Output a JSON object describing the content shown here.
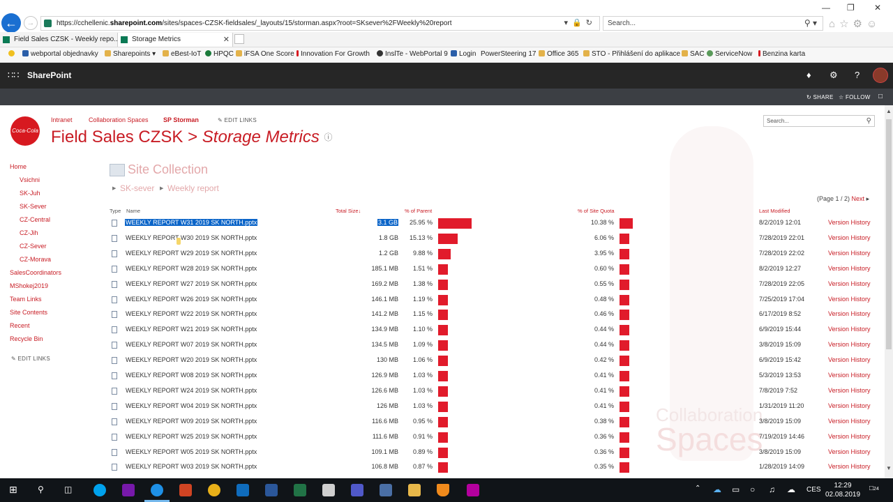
{
  "browser": {
    "url_prefix": "https://cchellenic.",
    "url_host": "sharepoint.com",
    "url_rest": "/sites/spaces-CZSK-fieldsales/_layouts/15/storman.aspx?root=SKsever%2FWeekly%20report",
    "search_placeholder": "Search...",
    "tabs": [
      {
        "label": "Field Sales CZSK - Weekly repo..."
      },
      {
        "label": "Storage Metrics"
      }
    ],
    "favorites": [
      "webportal objednavky",
      "Sharepoints",
      "eBest-IoT",
      "HPQC",
      "iFSA One Score",
      "Innovation For Growth",
      "InslTe - WebPortal 9",
      "Login",
      "PowerSteering 17",
      "Office 365",
      "STO - Přihlášení do aplikace",
      "SAC",
      "ServiceNow",
      "Benzina karta"
    ]
  },
  "suite": {
    "brand": "SharePoint",
    "share": "SHARE",
    "follow": "FOLLOW"
  },
  "site": {
    "logo_text": "Coca-Cola",
    "topnav": [
      "Intranet",
      "Collaboration Spaces",
      "SP Storman"
    ],
    "edit_links": "EDIT LINKS",
    "title_main": "Field Sales CZSK",
    "title_sep": " > ",
    "title_page": "Storage Metrics",
    "search_placeholder": "Search...",
    "leftnav": [
      {
        "label": "Home",
        "indent": false
      },
      {
        "label": "Vsichni",
        "indent": true
      },
      {
        "label": "SK-Juh",
        "indent": true
      },
      {
        "label": "SK-Sever",
        "indent": true
      },
      {
        "label": "CZ-Central",
        "indent": true
      },
      {
        "label": "CZ-Jih",
        "indent": true
      },
      {
        "label": "CZ-Sever",
        "indent": true
      },
      {
        "label": "CZ-Morava",
        "indent": true
      },
      {
        "label": "SalesCoordinators",
        "indent": false
      },
      {
        "label": "MShokej2019",
        "indent": false
      },
      {
        "label": "Team Links",
        "indent": false
      },
      {
        "label": "Site Contents",
        "indent": false
      },
      {
        "label": "Recent",
        "indent": false
      },
      {
        "label": "Recycle Bin",
        "indent": false
      }
    ],
    "leftnav_edit": "EDIT LINKS",
    "watermark_line1": "Collaboration",
    "watermark_line2": "Spaces"
  },
  "storage": {
    "heading": "Site Collection",
    "breadcrumb": [
      "SK-sever",
      "Weekly report"
    ],
    "pager_text": "(Page 1 / 2)",
    "pager_next": "Next",
    "columns": {
      "type": "Type",
      "name": "Name",
      "total_size": "Total Size",
      "pct_parent": "% of Parent",
      "pct_quota": "% of Site Quota",
      "last_modified": "Last Modified"
    },
    "version_history_label": "Version History",
    "rows": [
      {
        "name": "WEEKLY REPORT W31 2019 SK NORTH.pptx",
        "size": "3.1 GB",
        "parent": "25.95 %",
        "parent_val": 25.95,
        "quota": "10.38 %",
        "quota_val": 10.38,
        "modified": "8/2/2019 12:01",
        "selected": true
      },
      {
        "name": "WEEKLY REPORT W30 2019 SK NORTH.pptx",
        "size": "1.8 GB",
        "parent": "15.13 %",
        "parent_val": 15.13,
        "quota": "6.06 %",
        "quota_val": 6.06,
        "modified": "7/28/2019 22:01"
      },
      {
        "name": "WEEKLY REPORT W29 2019 SK NORTH.pptx",
        "size": "1.2 GB",
        "parent": "9.88 %",
        "parent_val": 9.88,
        "quota": "3.95 %",
        "quota_val": 3.95,
        "modified": "7/28/2019 22:02"
      },
      {
        "name": "WEEKLY REPORT W28 2019 SK NORTH.pptx",
        "size": "185.1 MB",
        "parent": "1.51 %",
        "parent_val": 1.51,
        "quota": "0.60 %",
        "quota_val": 0.6,
        "modified": "8/2/2019 12:27"
      },
      {
        "name": "WEEKLY REPORT W27 2019 SK NORTH.pptx",
        "size": "169.2 MB",
        "parent": "1.38 %",
        "parent_val": 1.38,
        "quota": "0.55 %",
        "quota_val": 0.55,
        "modified": "7/28/2019 22:05"
      },
      {
        "name": "WEEKLY REPORT W26 2019 SK NORTH.pptx",
        "size": "146.1 MB",
        "parent": "1.19 %",
        "parent_val": 1.19,
        "quota": "0.48 %",
        "quota_val": 0.48,
        "modified": "7/25/2019 17:04"
      },
      {
        "name": "WEEKLY REPORT W22 2019 SK NORTH.pptx",
        "size": "141.2 MB",
        "parent": "1.15 %",
        "parent_val": 1.15,
        "quota": "0.46 %",
        "quota_val": 0.46,
        "modified": "6/17/2019 8:52"
      },
      {
        "name": "WEEKLY REPORT W21 2019 SK NORTH.pptx",
        "size": "134.9 MB",
        "parent": "1.10 %",
        "parent_val": 1.1,
        "quota": "0.44 %",
        "quota_val": 0.44,
        "modified": "6/9/2019 15:44"
      },
      {
        "name": "WEEKLY REPORT W07 2019 SK NORTH.pptx",
        "size": "134.5 MB",
        "parent": "1.09 %",
        "parent_val": 1.09,
        "quota": "0.44 %",
        "quota_val": 0.44,
        "modified": "3/8/2019 15:09"
      },
      {
        "name": "WEEKLY REPORT W20 2019 SK NORTH.pptx",
        "size": "130 MB",
        "parent": "1.06 %",
        "parent_val": 1.06,
        "quota": "0.42 %",
        "quota_val": 0.42,
        "modified": "6/9/2019 15:42"
      },
      {
        "name": "WEEKLY REPORT W08 2019 SK NORTH.pptx",
        "size": "126.9 MB",
        "parent": "1.03 %",
        "parent_val": 1.03,
        "quota": "0.41 %",
        "quota_val": 0.41,
        "modified": "5/3/2019 13:53"
      },
      {
        "name": "WEEKLY REPORT W24 2019 SK NORTH.pptx",
        "size": "126.6 MB",
        "parent": "1.03 %",
        "parent_val": 1.03,
        "quota": "0.41 %",
        "quota_val": 0.41,
        "modified": "7/8/2019 7:52"
      },
      {
        "name": "WEEKLY REPORT W04 2019 SK NORTH.pptx",
        "size": "126 MB",
        "parent": "1.03 %",
        "parent_val": 1.03,
        "quota": "0.41 %",
        "quota_val": 0.41,
        "modified": "1/31/2019 11:20"
      },
      {
        "name": "WEEKLY REPORT W09 2019 SK NORTH.pptx",
        "size": "116.6 MB",
        "parent": "0.95 %",
        "parent_val": 0.95,
        "quota": "0.38 %",
        "quota_val": 0.38,
        "modified": "3/8/2019 15:09"
      },
      {
        "name": "WEEKLY REPORT W25 2019 SK NORTH.pptx",
        "size": "111.6 MB",
        "parent": "0.91 %",
        "parent_val": 0.91,
        "quota": "0.36 %",
        "quota_val": 0.36,
        "modified": "7/19/2019 14:46"
      },
      {
        "name": "WEEKLY REPORT W05 2019 SK NORTH.pptx",
        "size": "109.1 MB",
        "parent": "0.89 %",
        "parent_val": 0.89,
        "quota": "0.36 %",
        "quota_val": 0.36,
        "modified": "3/8/2019 15:09"
      },
      {
        "name": "WEEKLY REPORT W03 2019 SK NORTH.pptx",
        "size": "106.8 MB",
        "parent": "0.87 %",
        "parent_val": 0.87,
        "quota": "0.35 %",
        "quota_val": 0.35,
        "modified": "1/28/2019 14:09"
      }
    ]
  },
  "taskbar": {
    "lang": "CES",
    "time": "12:29",
    "date": "02.08.2019",
    "notifications": "24"
  }
}
